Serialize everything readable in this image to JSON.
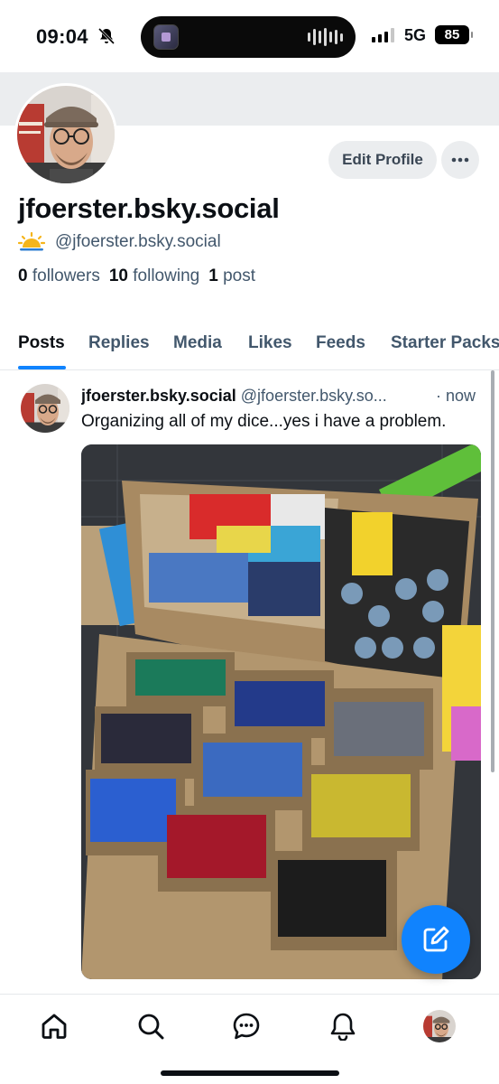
{
  "status_bar": {
    "time": "09:04",
    "network": "5G",
    "battery": "85"
  },
  "profile": {
    "display_name": "jfoerster.bsky.social",
    "handle": "@jfoerster.bsky.social",
    "edit_button": "Edit Profile",
    "stats": {
      "followers_count": "0",
      "followers_label": "followers",
      "following_count": "10",
      "following_label": "following",
      "posts_count": "1",
      "posts_label": "post"
    }
  },
  "tabs": [
    {
      "label": "Posts",
      "active": true
    },
    {
      "label": "Replies",
      "active": false
    },
    {
      "label": "Media",
      "active": false
    },
    {
      "label": "Likes",
      "active": false
    },
    {
      "label": "Feeds",
      "active": false
    },
    {
      "label": "Starter Packs",
      "active": false
    }
  ],
  "post": {
    "author_name": "jfoerster.bsky.social",
    "author_handle": "@jfoerster.bsky.so...",
    "time": "· now",
    "text": "Organizing all of my dice...yes i have a problem."
  },
  "nav": [
    "home-icon",
    "search-icon",
    "chat-icon",
    "bell-icon",
    "profile-avatar"
  ],
  "colors": {
    "accent": "#1083fe",
    "muted_text": "#42576c",
    "banner": "#ebedef"
  }
}
